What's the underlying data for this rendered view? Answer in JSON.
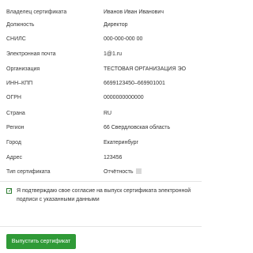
{
  "certificate_fields": [
    {
      "label": "Владелец сертификата",
      "value": "Иванов Иван Иванович"
    },
    {
      "label": "Должность",
      "value": "Директор"
    },
    {
      "label": "СНИЛС",
      "value": "000-000-000 00"
    },
    {
      "label": "Электронная почта",
      "value": "1@1.ru"
    },
    {
      "label": "Организация",
      "value": "ТЕСТОВАЯ ОРГАНИЗАЦИЯ ЭО"
    },
    {
      "label": "ИНН–КПП",
      "value": "6699123450–669901001"
    },
    {
      "label": "ОГРН",
      "value": "0000000000000"
    },
    {
      "label": "Страна",
      "value": "RU"
    },
    {
      "label": "Регион",
      "value": "66 Свердловская область"
    },
    {
      "label": "Город",
      "value": "Екатеринбург"
    },
    {
      "label": "Адрес",
      "value": "123456"
    },
    {
      "label": "Тип сертификата",
      "value": "Отчётность"
    }
  ],
  "consent": {
    "checked": true,
    "text": "Я подтверждаю свое согласие на выпуск сертификата электронной подписи с указанными данными"
  },
  "actions": {
    "issue_button_label": "Выпустить сертификат"
  },
  "colors": {
    "accent": "#2f9a37",
    "checkbox": "#2e7d32",
    "divider": "#e6e6e6"
  },
  "icons": {
    "certificate_type_help": "help-icon"
  }
}
